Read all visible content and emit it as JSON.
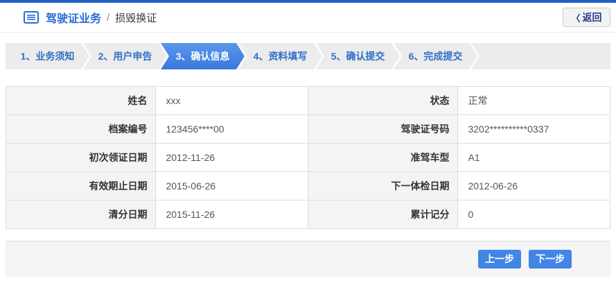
{
  "header": {
    "title": "驾驶证业务",
    "separator": "/",
    "subtitle": "损毁换证",
    "back_chevron": "〈",
    "back_label": "返回"
  },
  "steps": [
    {
      "label": "1、业务须知",
      "active": false
    },
    {
      "label": "2、用户申告",
      "active": false
    },
    {
      "label": "3、确认信息",
      "active": true
    },
    {
      "label": "4、资料填写",
      "active": false
    },
    {
      "label": "5、确认提交",
      "active": false
    },
    {
      "label": "6、完成提交",
      "active": false
    }
  ],
  "table": {
    "rows": [
      {
        "label_left": "姓名",
        "value_left": "xxx",
        "label_right": "状态",
        "value_right": "正常"
      },
      {
        "label_left": "档案编号",
        "value_left": "123456****00",
        "label_right": "驾驶证号码",
        "value_right": "3202**********0337"
      },
      {
        "label_left": "初次领证日期",
        "value_left": "2012-11-26",
        "label_right": "准驾车型",
        "value_right": "A1"
      },
      {
        "label_left": "有效期止日期",
        "value_left": "2015-06-26",
        "label_right": "下一体检日期",
        "value_right": "2012-06-26"
      },
      {
        "label_left": "清分日期",
        "value_left": "2015-11-26",
        "label_right": "累计记分",
        "value_right": "0"
      }
    ]
  },
  "footer": {
    "prev_label": "上一步",
    "next_label": "下一步"
  },
  "colors": {
    "top-border": "#1e5fc6",
    "accent": "#2a6bd4",
    "step-text": "#2e6fc9",
    "active-step-top": "#5a96ec",
    "active-step-bottom": "#3a79dd",
    "button-blue": "#4285e4",
    "label-bg": "#f4f4f4",
    "footer-bg": "#f5f5f5",
    "border": "#dddddd",
    "back-text": "#2b3990"
  }
}
